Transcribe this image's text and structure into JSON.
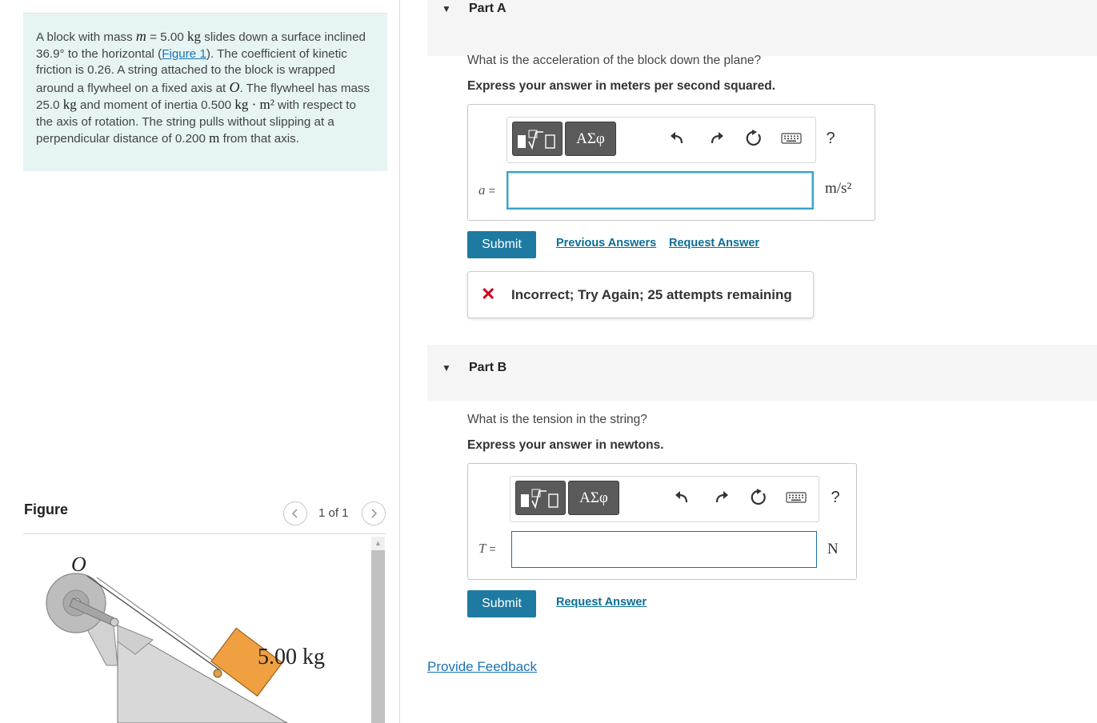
{
  "problem": {
    "t1": "A block with mass ",
    "m_var": "m",
    "t2": " = 5.00 ",
    "kg1": "kg",
    "t3": " slides down a surface inclined 36.9° to the horizontal (",
    "figure_link": "Figure 1",
    "t4": "). The coefficient of kinetic friction is 0.26. A string attached to the block is wrapped around a flywheel on a fixed axis at ",
    "o_var": "O",
    "t5": ". The flywheel has mass 25.0 ",
    "kg2": "kg",
    "t6": " and moment of inertia 0.500 ",
    "kgm2": "kg · m²",
    "t7": " with respect to the axis of rotation. The string pulls without slipping at a perpendicular distance of 0.200 ",
    "m_unit": "m",
    "t8": " from that axis."
  },
  "figure": {
    "title": "Figure",
    "count": "1 of 1",
    "prev_icon": "chevron-left",
    "next_icon": "chevron-right",
    "label_o": "O",
    "label_mass": "5.00 kg",
    "colors": {
      "block": "#f0a040",
      "incline": "#d8d8d8",
      "wheel": "#bcbcbc"
    }
  },
  "part_a": {
    "caret": "▼",
    "title": "Part A",
    "question": "What is the acceleration of the block down the plane?",
    "instruction": "Express your answer in meters per second squared.",
    "toolbar": {
      "template_icon": "template-icon",
      "greek": "ΑΣφ",
      "help": "?"
    },
    "var_name": "a",
    "var_eq": "=",
    "input_value": "",
    "unit": "m/s²",
    "submit": "Submit",
    "previous_answers": "Previous Answers",
    "request_answer": "Request Answer",
    "feedback_icon": "✕",
    "feedback": "Incorrect; Try Again; 25 attempts remaining"
  },
  "part_b": {
    "caret": "▼",
    "title": "Part B",
    "question": "What is the tension in the string?",
    "instruction": "Express your answer in newtons.",
    "toolbar": {
      "template_icon": "template-icon",
      "greek": "ΑΣφ",
      "help": "?"
    },
    "var_name": "T",
    "var_eq": "=",
    "input_value": "",
    "unit": "N",
    "submit": "Submit",
    "request_answer": "Request Answer"
  },
  "provide_feedback": "Provide Feedback",
  "colors": {
    "submit": "#1e7aa1",
    "link": "#0b6e95",
    "error": "#d0021b",
    "problem_bg": "#e6f4f4"
  }
}
